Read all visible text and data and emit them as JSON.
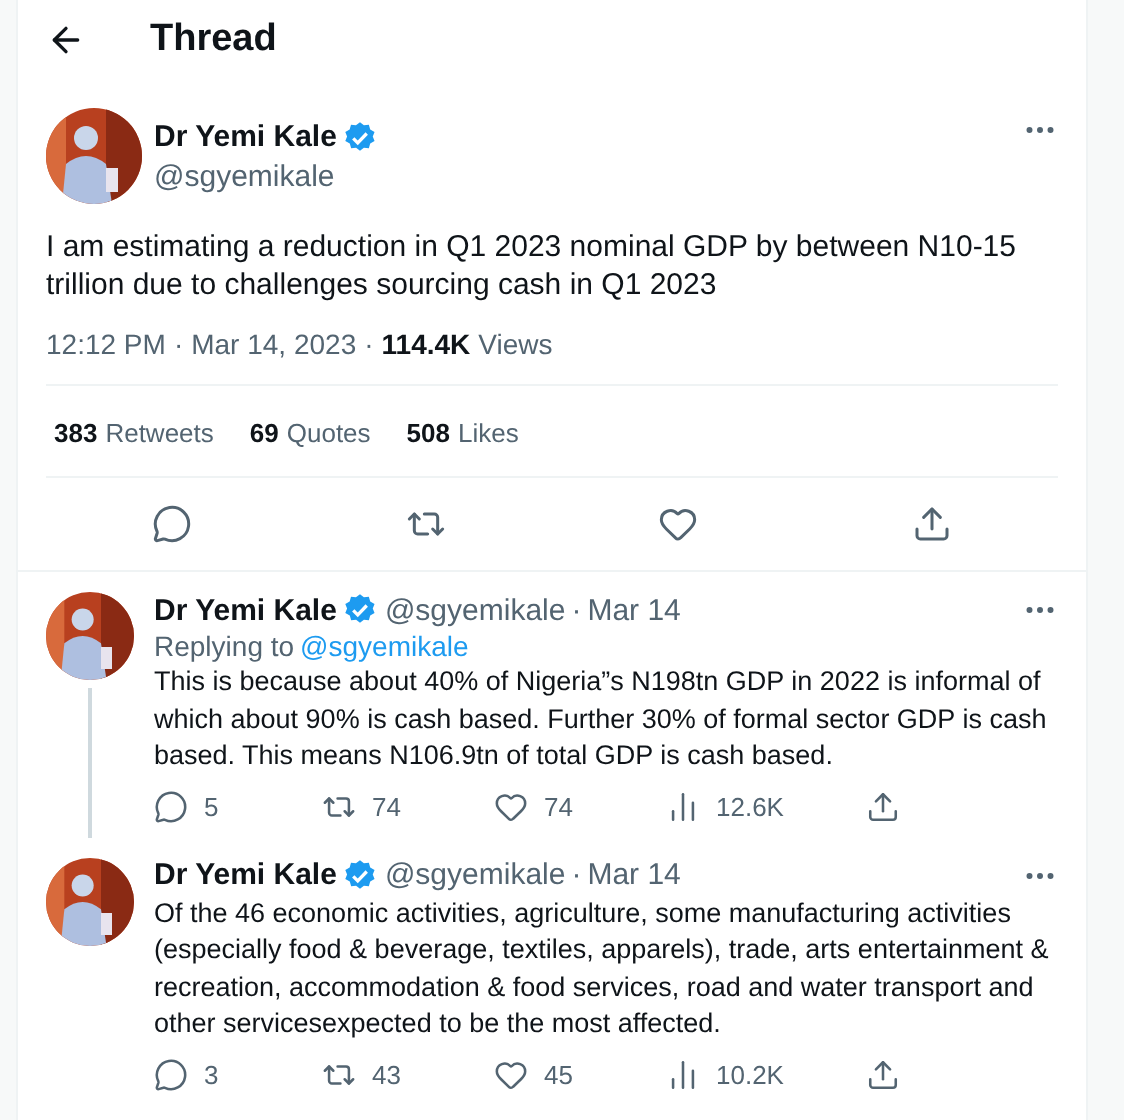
{
  "header": {
    "title": "Thread"
  },
  "separator": "·",
  "main_tweet": {
    "name": "Dr Yemi Kale",
    "verified": true,
    "handle": "@sgyemikale",
    "text": "I am estimating a reduction in Q1 2023 nominal GDP by between N10-15 trillion due to challenges sourcing cash in Q1 2023",
    "time": "12:12 PM",
    "date": "Mar 14, 2023",
    "views": "114.4K",
    "views_label": "Views",
    "stats": [
      {
        "count": "383",
        "label": "Retweets"
      },
      {
        "count": "69",
        "label": "Quotes"
      },
      {
        "count": "508",
        "label": "Likes"
      }
    ],
    "actions": [
      {
        "kind": "reply"
      },
      {
        "kind": "retweet"
      },
      {
        "kind": "like"
      },
      {
        "kind": "share"
      }
    ]
  },
  "replies": [
    {
      "name": "Dr Yemi Kale",
      "verified": true,
      "handle": "@sgyemikale",
      "date": "Mar 14",
      "connected_below": true,
      "replying_to": {
        "label": "Replying to",
        "handle": "@sgyemikale"
      },
      "text": "This is because about 40% of Nigeria”s N198tn GDP in 2022 is informal of which about 90% is cash based. Further 30% of formal sector GDP is cash based. This means N106.9tn of total GDP is cash based.",
      "actions": [
        {
          "kind": "reply",
          "count": "5"
        },
        {
          "kind": "retweet",
          "count": "74"
        },
        {
          "kind": "like",
          "count": "74"
        },
        {
          "kind": "views",
          "count": "12.6K"
        },
        {
          "kind": "share"
        }
      ]
    },
    {
      "name": "Dr Yemi Kale",
      "verified": true,
      "handle": "@sgyemikale",
      "date": "Mar 14",
      "connected_below": false,
      "text": "Of the 46 economic activities, agriculture, some manufacturing activities (especially food & beverage, textiles, apparels), trade, arts entertainment & recreation, accommodation & food services, road and water transport and other servicesexpected to be the most affected.",
      "actions": [
        {
          "kind": "reply",
          "count": "3"
        },
        {
          "kind": "retweet",
          "count": "43"
        },
        {
          "kind": "like",
          "count": "45"
        },
        {
          "kind": "views",
          "count": "10.2K"
        },
        {
          "kind": "share"
        }
      ]
    }
  ]
}
